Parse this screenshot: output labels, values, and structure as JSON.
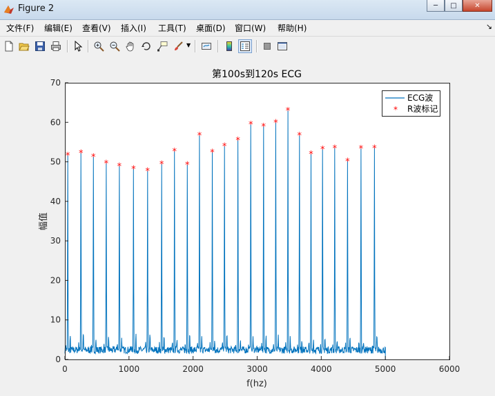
{
  "window": {
    "title": "Figure 2",
    "icon": "matlab-icon",
    "controls": {
      "minimize": "minimize-icon",
      "maximize": "maximize-icon",
      "close": "close-icon"
    }
  },
  "menu": {
    "items": [
      "文件(F)",
      "编辑(E)",
      "查看(V)",
      "插入(I)",
      "工具(T)",
      "桌面(D)",
      "窗口(W)",
      "帮助(H)"
    ],
    "end_icon": "dock-arrow-icon"
  },
  "toolbar": {
    "buttons": [
      "new-figure-icon",
      "open-icon",
      "save-icon",
      "print-icon",
      "pointer-icon",
      "zoom-in-icon",
      "zoom-out-icon",
      "pan-icon",
      "rotate-icon",
      "data-cursor-icon",
      "brush-icon",
      "link-icon",
      "colorbar-icon",
      "legend-icon",
      "hide-plot-tools-icon",
      "show-plot-tools-icon"
    ]
  },
  "colors": {
    "line": "#0072bd",
    "marker": "#ff0000",
    "axes": "#262626",
    "background": "#ffffff",
    "figure": "#f0f0f0"
  },
  "chart_data": {
    "type": "line",
    "title": "第100s到120s ECG",
    "xlabel": "f(hz)",
    "ylabel": "幅值",
    "xlim": [
      0,
      6000
    ],
    "ylim": [
      0,
      70
    ],
    "xticks": [
      0,
      1000,
      2000,
      3000,
      4000,
      5000,
      6000
    ],
    "yticks": [
      0,
      10,
      20,
      30,
      40,
      50,
      60,
      70
    ],
    "grid": false,
    "legend": {
      "position": "top-right",
      "entries": [
        "ECG波",
        "R波标记"
      ]
    },
    "series": [
      {
        "name": "ECG波",
        "style": "line",
        "x_range": [
          0,
          5000
        ],
        "baseline_level": 1.5,
        "peak_x": [
          45,
          250,
          445,
          645,
          850,
          1070,
          1290,
          1510,
          1710,
          1910,
          2100,
          2300,
          2490,
          2700,
          2900,
          3100,
          3290,
          3480,
          3660,
          3840,
          4020,
          4210,
          4410,
          4620,
          4830
        ]
      },
      {
        "name": "R波标记",
        "style": "marker-asterisk",
        "x": [
          45,
          250,
          445,
          645,
          850,
          1070,
          1290,
          1510,
          1710,
          1910,
          2100,
          2300,
          2490,
          2700,
          2900,
          3100,
          3290,
          3480,
          3660,
          3840,
          4020,
          4210,
          4410,
          4620,
          4830
        ],
        "y": [
          51.7,
          52.3,
          51.3,
          49.7,
          49.0,
          48.3,
          47.7,
          49.5,
          52.7,
          49.3,
          56.7,
          52.5,
          54.0,
          55.5,
          59.5,
          59.0,
          60.0,
          63.0,
          56.7,
          52.0,
          53.2,
          53.5,
          50.2,
          53.4,
          53.5
        ]
      }
    ]
  }
}
